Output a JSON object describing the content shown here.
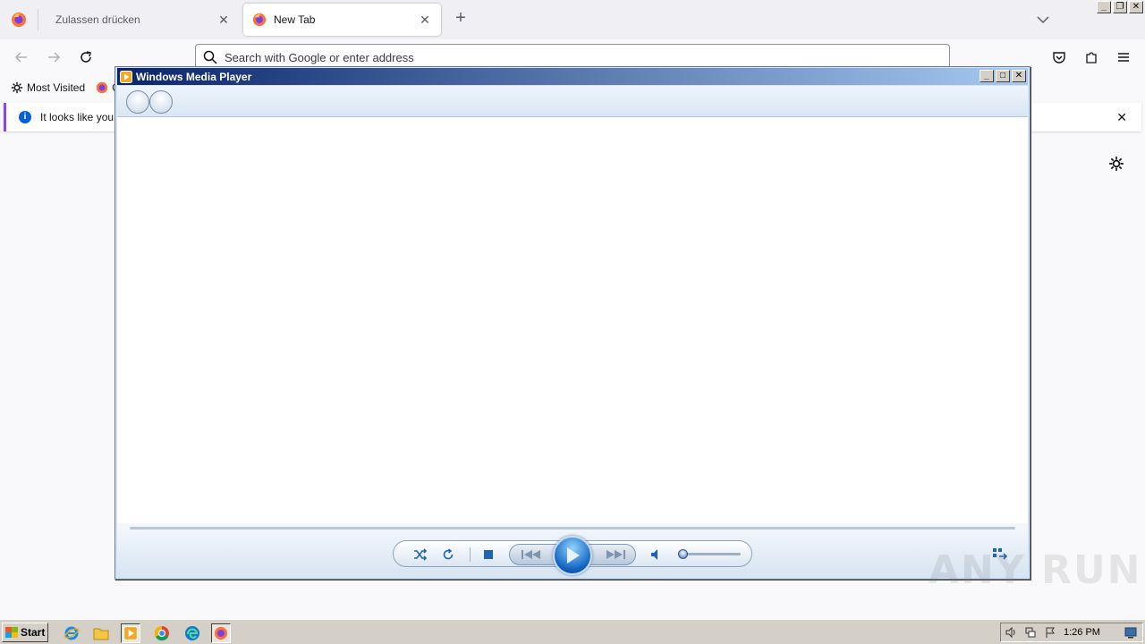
{
  "browser": {
    "tabs": [
      {
        "label": "Zulassen drücken",
        "active": false
      },
      {
        "label": "New Tab",
        "active": true
      }
    ],
    "address_placeholder": "Search with Google or enter address",
    "bookmarks": [
      {
        "label": "Most Visited",
        "icon": "gear-icon"
      },
      {
        "label": "G",
        "icon": "firefox-icon"
      }
    ],
    "notification_text": "It looks like you h"
  },
  "wmp": {
    "title": "Windows Media Player"
  },
  "taskbar": {
    "start_label": "Start",
    "clock": "1:26 PM"
  },
  "watermark": "ANY RUN",
  "colors": {
    "wmp_title_start": "#0a246a",
    "wmp_title_end": "#a6caf0",
    "wmp_accent": "#1d64b9",
    "taskbar": "#d4d0c8"
  }
}
